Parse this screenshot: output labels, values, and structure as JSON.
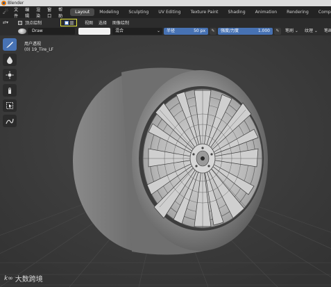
{
  "window": {
    "title": "Blender"
  },
  "menu": {
    "items": [
      "文件",
      "编辑",
      "渲染",
      "窗口",
      "帮助"
    ]
  },
  "workspaces": {
    "active": "Layout",
    "tabs": [
      "Layout",
      "Modeling",
      "Sculpting",
      "UV Editing",
      "Texture Paint",
      "Shading",
      "Animation",
      "Rendering",
      "Compositing"
    ]
  },
  "tool_header": {
    "mode_label": "顶点绘制",
    "view_menu": [
      "视图",
      "选择",
      "图像绘制"
    ]
  },
  "tool_settings": {
    "brush_name": "Draw",
    "blend_mode": "混合",
    "radius_label": "半径",
    "radius_value": "50 px",
    "strength_label": "强度/力度",
    "strength_value": "1.000",
    "dropdowns": [
      "笔刷",
      "纹理",
      "笔画"
    ]
  },
  "viewport": {
    "view_name": "用户透视",
    "object_label": "(0) 19_Tire_LF"
  },
  "toolbar": {
    "tools": [
      "draw-brush",
      "blur-drop",
      "average-star",
      "smear-finger",
      "box-select",
      "annotate-curve"
    ]
  },
  "watermark": {
    "text": "大数跨境"
  },
  "colors": {
    "accent": "#4772b3",
    "highlight": "#e3e53c",
    "background": "#3d3d3d"
  }
}
